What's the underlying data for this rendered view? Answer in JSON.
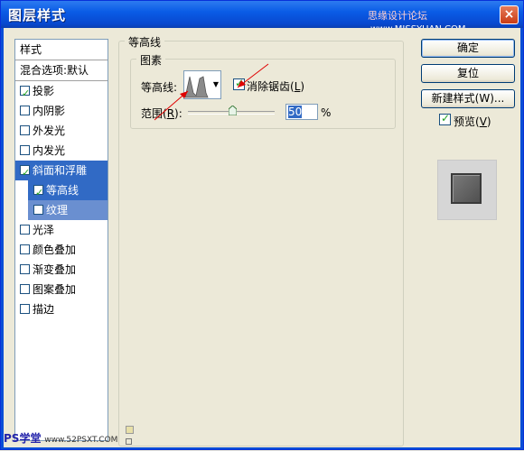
{
  "window": {
    "title": "图层样式",
    "watermark_cn": "思缘设计论坛",
    "watermark_url": "www.MISSYUAN.COM",
    "close_label": "×"
  },
  "style_list": {
    "header": "样式",
    "blend_options": "混合选项:默认",
    "items": [
      {
        "label": "投影",
        "checked": true
      },
      {
        "label": "内阴影",
        "checked": false
      },
      {
        "label": "外发光",
        "checked": false
      },
      {
        "label": "内发光",
        "checked": false
      },
      {
        "label": "斜面和浮雕",
        "checked": true,
        "selected": true
      },
      {
        "label": "等高线",
        "checked": true,
        "sub": true,
        "selected": true
      },
      {
        "label": "纹理",
        "checked": false,
        "sub": true
      },
      {
        "label": "光泽",
        "checked": false
      },
      {
        "label": "颜色叠加",
        "checked": false
      },
      {
        "label": "渐变叠加",
        "checked": false
      },
      {
        "label": "图案叠加",
        "checked": false
      },
      {
        "label": "描边",
        "checked": false
      }
    ]
  },
  "contour_panel": {
    "group_title": "等高线",
    "sub_group_title": "图素",
    "contour_label": "等高线:",
    "antialias_label_prefix": "消除锯齿(",
    "antialias_key": "L",
    "antialias_label_suffix": ")",
    "antialias_checked": true,
    "range_label_prefix": "范围(",
    "range_key": "R",
    "range_label_suffix": "):",
    "range_value": "50",
    "range_unit": "%",
    "range_slider_value": 0.5
  },
  "buttons": {
    "ok": "确定",
    "reset": "复位",
    "new_style": "新建样式(W)...",
    "preview_prefix": "预览(",
    "preview_key": "V",
    "preview_suffix": ")",
    "preview_checked": true
  },
  "footer": {
    "watermark_a": "PS学堂",
    "watermark_b": "www.52PSXT.COM"
  },
  "colors": {
    "titlebar": "#0a5ce6",
    "selection": "#316ac5",
    "check": "#21a121",
    "annotation_arrow": "#e00000"
  }
}
